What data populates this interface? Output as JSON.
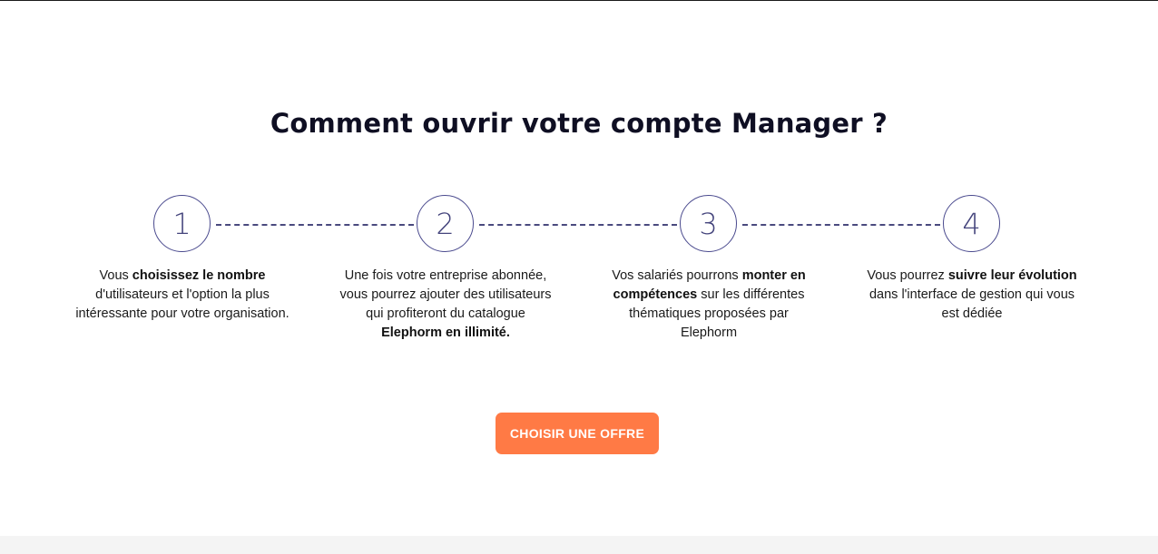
{
  "section": {
    "title": "Comment ouvrir votre compte Manager ?"
  },
  "steps": [
    {
      "number": "1",
      "text": [
        {
          "t": "Vous ",
          "b": false
        },
        {
          "t": "choisissez le nombre",
          "b": true
        },
        {
          "t": " d'utilisateurs et l'option la plus intéressante pour votre organisation.",
          "b": false
        }
      ]
    },
    {
      "number": "2",
      "text": [
        {
          "t": "Une fois votre entreprise abonnée, vous pourrez ajouter des utilisateurs qui profiteront du catalogue ",
          "b": false
        },
        {
          "t": "Elephorm en illimité.",
          "b": true
        }
      ]
    },
    {
      "number": "3",
      "text": [
        {
          "t": "Vos salariés pourrons ",
          "b": false
        },
        {
          "t": "monter en compétences",
          "b": true
        },
        {
          "t": " sur les différentes thématiques proposées par Elephorm",
          "b": false
        }
      ]
    },
    {
      "number": "4",
      "text": [
        {
          "t": "Vous pourrez ",
          "b": false
        },
        {
          "t": "suivre leur évolution",
          "b": true
        },
        {
          "t": " dans l'interface de gestion qui vous est dédiée",
          "b": false
        }
      ]
    }
  ],
  "cta": {
    "label": "CHOISIR UNE OFFRE",
    "background": "#ff7a45",
    "text_color": "#ffffff"
  },
  "colors": {
    "title": "#0f0f23",
    "circle_border": "#4a4a8e",
    "number": "#44447c",
    "connector": "#4a4a7e",
    "footer_band": "#f4f4f4"
  }
}
